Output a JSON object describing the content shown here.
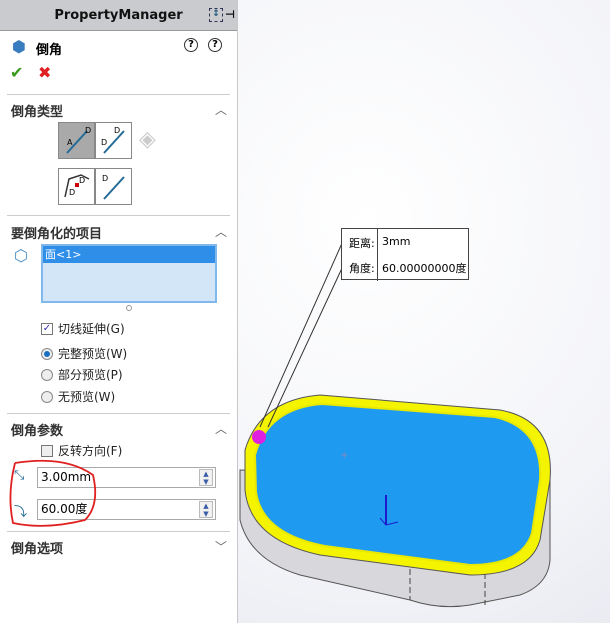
{
  "header": {
    "title": "PropertyManager"
  },
  "feature": {
    "title": "倒角"
  },
  "section_type": {
    "title": "倒角类型"
  },
  "section_items": {
    "title": "要倒角化的项目",
    "selection": "面<1>",
    "tangent_label": "切线延伸(G)",
    "tangent_checked": true,
    "preview_options": [
      {
        "label": "完整预览(W)",
        "selected": true
      },
      {
        "label": "部分预览(P)",
        "selected": false
      },
      {
        "label": "无预览(W)",
        "selected": false
      }
    ]
  },
  "section_params": {
    "title": "倒角参数",
    "reverse_label": "反转方向(F)",
    "reverse_checked": false,
    "distance": "3.00mm",
    "angle": "60.00度"
  },
  "section_options": {
    "title": "倒角选项"
  },
  "callout": {
    "distance_label": "距离:",
    "distance_value": "3mm",
    "angle_label": "角度:",
    "angle_value": "60.00000000度"
  },
  "colors": {
    "face": "#1e9bf0",
    "edge": "#f4f400",
    "annotation": "#e02020"
  }
}
